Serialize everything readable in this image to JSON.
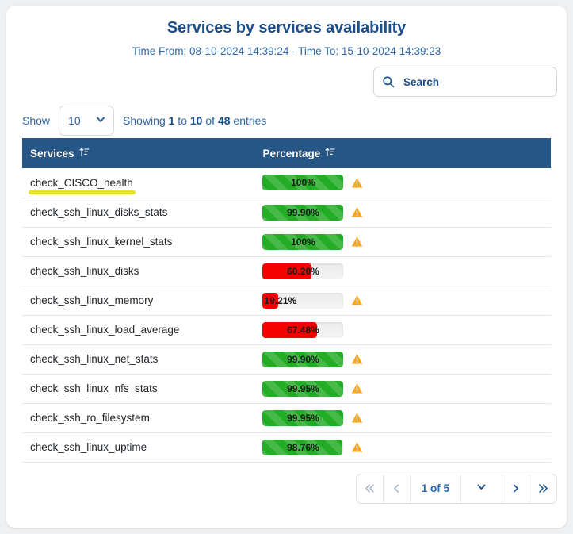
{
  "header": {
    "title": "Services by services availability",
    "subtitle": "Time From: 08-10-2024 14:39:24 - Time To: 15-10-2024 14:39:23"
  },
  "search": {
    "placeholder": "Search",
    "value": "",
    "icon": "search-icon"
  },
  "controls": {
    "show_label": "Show",
    "page_length": "10",
    "info_prefix": "Showing ",
    "info_from": "1",
    "info_mid1": " to ",
    "info_to": "10",
    "info_mid2": " of ",
    "info_total": "48",
    "info_suffix": " entries"
  },
  "table": {
    "columns": [
      {
        "label": "Services",
        "sort_icon": "sort-amount-up-icon"
      },
      {
        "label": "Percentage",
        "sort_icon": "sort-amount-up-icon"
      }
    ],
    "rows": [
      {
        "service": "check_CISCO_health",
        "percentage": "100%",
        "value": 100,
        "color": "green",
        "warning": true,
        "highlighted": true
      },
      {
        "service": "check_ssh_linux_disks_stats",
        "percentage": "99.90%",
        "value": 99.9,
        "color": "green",
        "warning": true,
        "highlighted": false
      },
      {
        "service": "check_ssh_linux_kernel_stats",
        "percentage": "100%",
        "value": 100,
        "color": "green",
        "warning": true,
        "highlighted": false
      },
      {
        "service": "check_ssh_linux_disks",
        "percentage": "60.20%",
        "value": 60.2,
        "color": "red",
        "warning": false,
        "highlighted": false
      },
      {
        "service": "check_ssh_linux_memory",
        "percentage": "19.21%",
        "value": 19.21,
        "color": "red",
        "warning": true,
        "highlighted": false
      },
      {
        "service": "check_ssh_linux_load_average",
        "percentage": "67.48%",
        "value": 67.48,
        "color": "red",
        "warning": false,
        "highlighted": false
      },
      {
        "service": "check_ssh_linux_net_stats",
        "percentage": "99.90%",
        "value": 99.9,
        "color": "green",
        "warning": true,
        "highlighted": false
      },
      {
        "service": "check_ssh_linux_nfs_stats",
        "percentage": "99.95%",
        "value": 99.95,
        "color": "green",
        "warning": true,
        "highlighted": false
      },
      {
        "service": "check_ssh_ro_filesystem",
        "percentage": "99.95%",
        "value": 99.95,
        "color": "green",
        "warning": true,
        "highlighted": false
      },
      {
        "service": "check_ssh_linux_uptime",
        "percentage": "98.76%",
        "value": 98.76,
        "color": "green",
        "warning": true,
        "highlighted": false
      }
    ]
  },
  "pagination": {
    "status": "1 of 5",
    "current_page": 1,
    "total_pages": 5,
    "first_icon": "double-chevron-left-icon",
    "prev_icon": "chevron-left-icon",
    "select_icon": "chevron-down-icon",
    "next_icon": "chevron-right-icon",
    "last_icon": "double-chevron-right-icon"
  },
  "colors": {
    "header_blue": "#255686",
    "title_blue": "#1b4f8a",
    "green": "#23ac26",
    "red": "#f40000",
    "warning_orange": "#f5a623",
    "highlight_yellow": "#e4e52b",
    "page_bg": "#eef0f2"
  }
}
